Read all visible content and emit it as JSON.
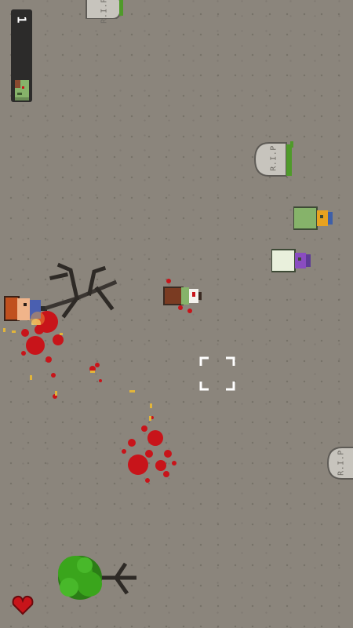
{
  "hud": {
    "kill_count": "1",
    "zombie_icon": "zombie-head-icon"
  },
  "tombstones": [
    {
      "label": "R.I.P"
    },
    {
      "label": "R.I.P"
    },
    {
      "label": "R.I.P"
    }
  ],
  "player": {
    "icon": "survivor-icon"
  },
  "lives": {
    "icon": "heart-icon"
  },
  "aim": {
    "icon": "crosshair-icon"
  },
  "colors": {
    "ground": "#8b857c",
    "blood": "#c8141a",
    "zombie_skin": "#86b36a",
    "grass": "#4f9a2a",
    "tree_green": "#3aa51c",
    "bullet_casing": "#e2b53a"
  }
}
